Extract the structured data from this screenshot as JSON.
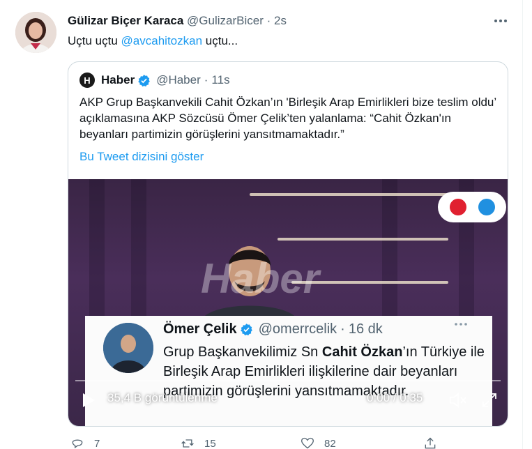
{
  "tweet": {
    "display_name": "Gülizar Biçer Karaca",
    "handle": "@GulizarBicer",
    "separator": "·",
    "time": "2s",
    "more_icon": "more-horizontal-icon",
    "text_before": "Uçtu uçtu ",
    "mention": "@avcahitozkan",
    "text_after": " uçtu..."
  },
  "quote": {
    "logo_letter": "H",
    "display_name": "Haber",
    "handle": "@Haber",
    "separator": "·",
    "time": "11s",
    "body": "AKP Grup Başkanvekili Cahit Özkan’ın 'Birleşik Arap Emirlikleri bize teslim oldu’ açıklamasına AKP Sözcüsü Ömer Çelik’ten yalanlama: “Cahit Özkan'ın beyanları partimizin görüşlerini yansıtmamaktadır.”",
    "thread_link": "Bu Tweet dizisini göster"
  },
  "video": {
    "watermark": "Haber",
    "card": {
      "name": "Ömer Çelik",
      "handle": "@omerrcelik",
      "separator": "·",
      "time": "16 dk",
      "text_1": "Grup Başkanvekilimiz Sn ",
      "text_bold": "Cahit Özkan",
      "text_2": "’ın Türkiye ile Birleşik Arap Emirlikleri ilişkilerine dair beyanları partimizin görüşlerini yansıtmamaktadır."
    },
    "views": "35,4 B görüntülenme",
    "timecode": "0:00 / 0:35",
    "progress": 0
  },
  "actions": {
    "replies": "7",
    "retweets": "15",
    "likes": "82"
  },
  "colors": {
    "link": "#1d9bf0",
    "muted": "#536471",
    "verified": "#1d9bf0",
    "border": "#cfd9de"
  }
}
